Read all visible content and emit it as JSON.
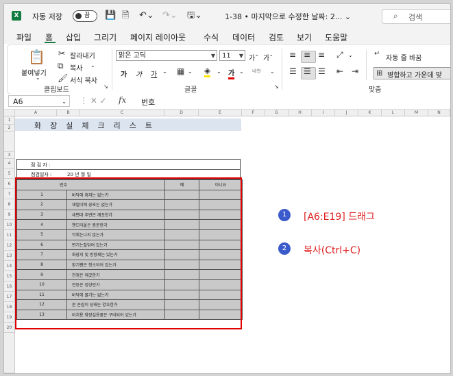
{
  "titlebar": {
    "app_logo": "X",
    "autosave_label": "자동 저장",
    "autosave_state": "끔",
    "doc_title": "1-38 • 마지막으로 수정한 날짜: 2... ⌄",
    "search_placeholder": "검색"
  },
  "tabs": [
    "파일",
    "홈",
    "삽입",
    "그리기",
    "페이지 레이아웃",
    "수식",
    "데이터",
    "검토",
    "보기",
    "도움말"
  ],
  "active_tab": "홈",
  "ribbon": {
    "paste_label": "붙여넣기",
    "cut_label": "잘라내기",
    "copy_label": "복사",
    "format_painter_label": "서식 복사",
    "clipboard_group": "클립보드",
    "font_name": "맑은 고딕",
    "font_size": "11",
    "font_group": "글꼴",
    "grow_font": "가ˆ",
    "shrink_font": "가ˇ",
    "bold": "가",
    "italic": "가",
    "underline": "가",
    "font_color_label": "가",
    "phonetic": "내천",
    "wrap_text_label": "자동 줄 바꿈",
    "merge_label": "병합하고 가운데 맞",
    "align_group": "맞춤"
  },
  "formula_bar": {
    "cell_ref": "A6",
    "formula": "번호"
  },
  "columns": [
    "A",
    "B",
    "C",
    "D",
    "E",
    "F",
    "G",
    "H",
    "I",
    "J",
    "K",
    "L",
    "M",
    "N"
  ],
  "rows": [
    "1",
    "2",
    "",
    "3",
    "4",
    "5",
    "6",
    "7",
    "8",
    "9",
    "10",
    "11",
    "12",
    "13",
    "14",
    "15",
    "16",
    "17",
    "18",
    "19",
    "20"
  ],
  "sheet": {
    "title": "화장실체크리스트",
    "inspector_label": "점 검 자 :",
    "date_label": "점검일자 :",
    "date_value": "20      년      월      일",
    "headers": {
      "no": "번호",
      "yes": "예",
      "no_ans": "아니요"
    },
    "items": [
      {
        "no": "1",
        "text": "바닥에 휴지는 없는가"
      },
      {
        "no": "2",
        "text": "재떨이에 꽁초는 없는가"
      },
      {
        "no": "3",
        "text": "세면대 주변은 깨끗한가"
      },
      {
        "no": "4",
        "text": "핸드타올은 충분한가"
      },
      {
        "no": "5",
        "text": "악취는나지 않는가"
      },
      {
        "no": "6",
        "text": "변기는잘닦여 있는가"
      },
      {
        "no": "7",
        "text": "화장지 및 방향제는 있는가"
      },
      {
        "no": "8",
        "text": "환기팬은 청소되어 있는가"
      },
      {
        "no": "9",
        "text": "천정은 깨끗한가"
      },
      {
        "no": "10",
        "text": "전등은 정상인가"
      },
      {
        "no": "11",
        "text": "바닥에 물기는 없는가"
      },
      {
        "no": "12",
        "text": "문 손잡이 상태는 양호한가"
      },
      {
        "no": "13",
        "text": "비치용 화장실용품은 구비되어 있는가"
      }
    ]
  },
  "annotations": [
    {
      "num": "1",
      "text": "[A6:E19] 드래그"
    },
    {
      "num": "2",
      "text": "복사(Ctrl+C)"
    }
  ],
  "colors": {
    "accent": "#107c41",
    "selection": "#e10000",
    "step_badge": "#3b5bcc",
    "step_text": "#e02020"
  }
}
